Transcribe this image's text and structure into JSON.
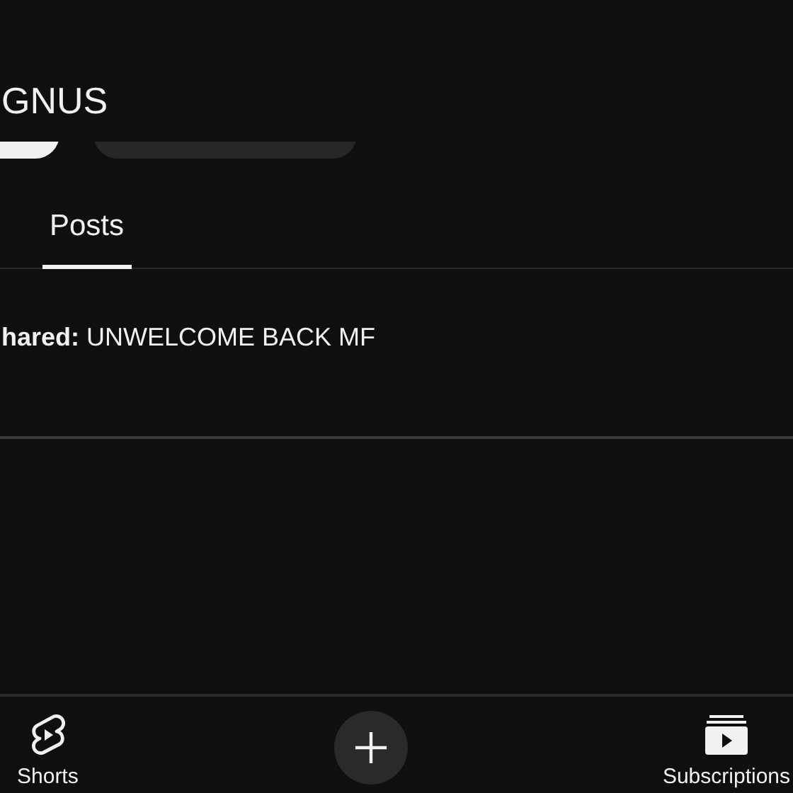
{
  "channel_name": "GNUS",
  "tabs": [
    {
      "label": "Posts",
      "selected": true
    }
  ],
  "post": {
    "text": "**hared:** UNWELCOME BACK MF"
  },
  "nav": [
    {
      "kind": "shorts",
      "label": "Shorts"
    },
    {
      "kind": "create"
    },
    {
      "kind": "subscriptions",
      "label": "Subscriptions"
    }
  ]
}
